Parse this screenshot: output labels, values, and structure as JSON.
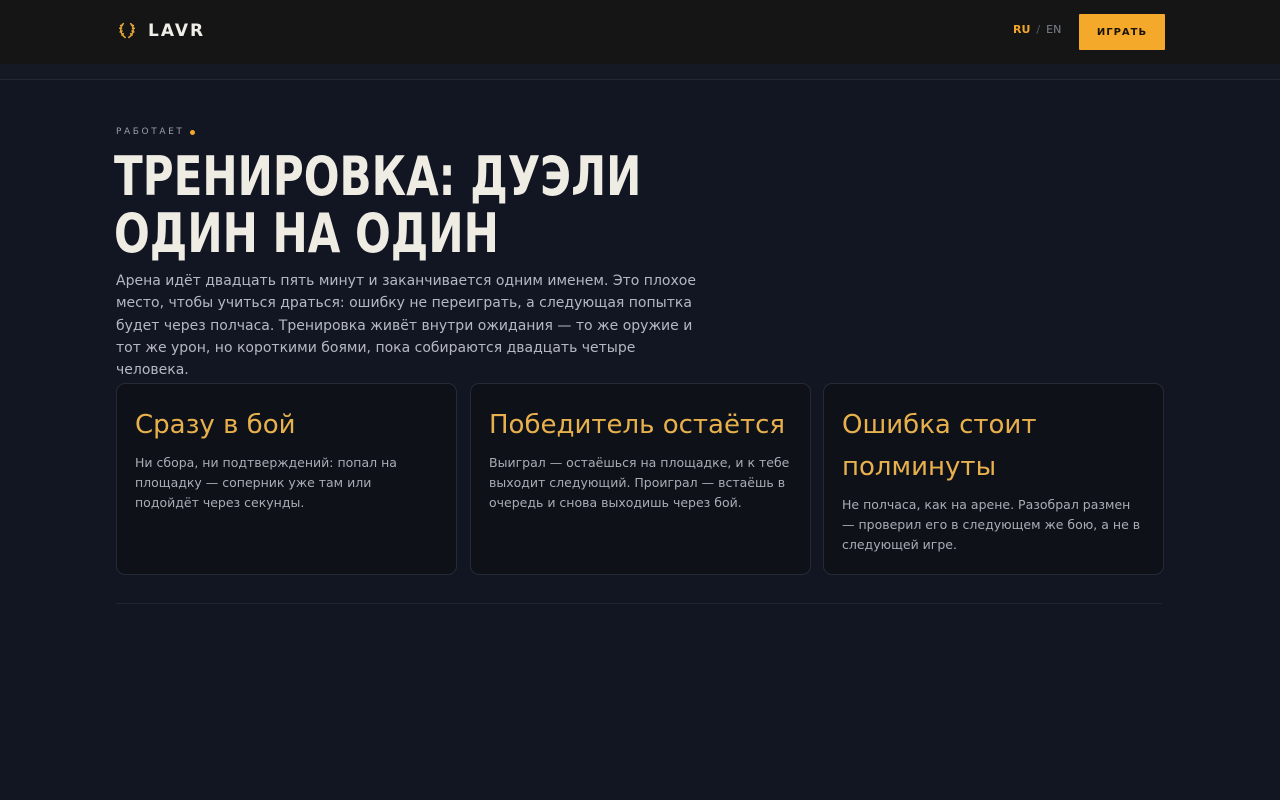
{
  "header": {
    "logo_text": "LAVR",
    "icon": "laurel-icon",
    "lang_ru": "RU",
    "lang_separator": "/",
    "lang_en": "EN",
    "play_label": "ИГРАТЬ"
  },
  "hero": {
    "status": "РАБОТАЕТ",
    "title_line1": "ТРЕНИРОВКА: ДУЭЛИ",
    "title_line2": "ОДИН НА ОДИН",
    "intro": "Арена идёт двадцать пять минут и заканчивается одним именем. Это плохое место, чтобы учиться драться: ошибку не переиграть, а следующая попытка будет через полчаса. Тренировка живёт внутри ожидания — то же оружие и тот же урон, но короткими боями, пока собираются двадцать четыре человека."
  },
  "cards": [
    {
      "title": "Сразу в бой",
      "text": "Ни сбора, ни подтверждений: попал на площадку — соперник уже там или подойдёт через секунды."
    },
    {
      "title": "Победитель остаётся",
      "text": "Выиграл — остаёшься на площадке, и к тебе выходит следующий. Проиграл — встаёшь в очередь и снова выходишь через бой."
    },
    {
      "title": "Ошибка стоит полминуты",
      "text": "Не полчаса, как на арене. Разобрал размен — проверил его в следующем же бою, а не в следующей игре."
    }
  ],
  "colors": {
    "accent": "#f4a92a",
    "background": "#121623",
    "header": "#151515"
  }
}
